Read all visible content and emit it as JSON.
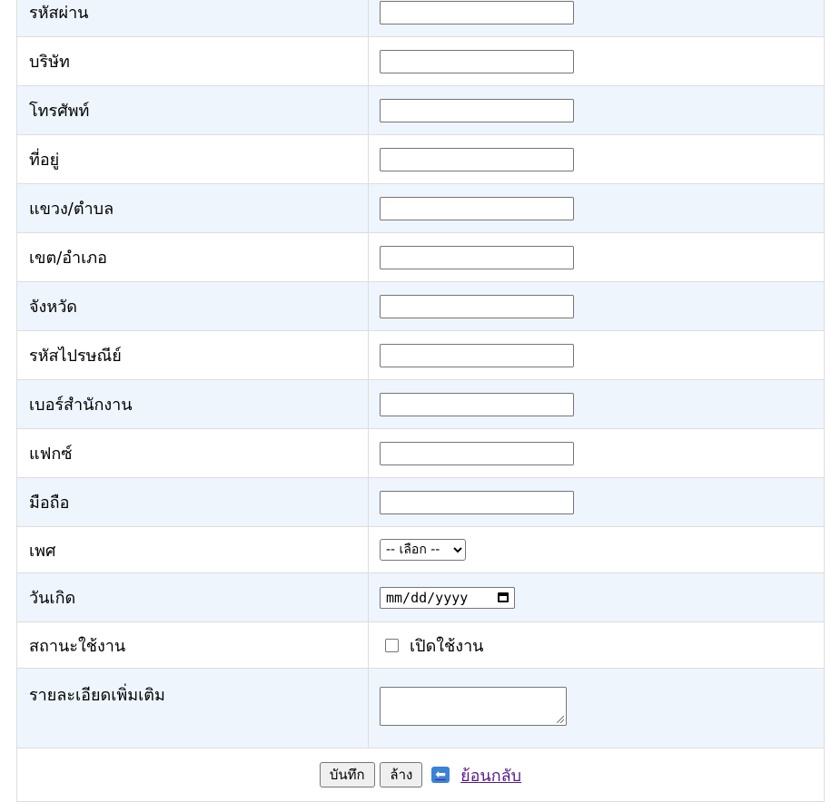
{
  "form": {
    "fields": [
      {
        "label": "รหัสผ่าน",
        "value": ""
      },
      {
        "label": "บริษัท",
        "value": ""
      },
      {
        "label": "โทรศัพท์",
        "value": ""
      },
      {
        "label": "ที่อยู่",
        "value": ""
      },
      {
        "label": "แขวง/ตำบล",
        "value": ""
      },
      {
        "label": "เขต/อำเภอ",
        "value": ""
      },
      {
        "label": "จังหวัด",
        "value": ""
      },
      {
        "label": "รหัสไปรษณีย์",
        "value": ""
      },
      {
        "label": "เบอร์สำนักงาน",
        "value": ""
      },
      {
        "label": "แฟกซ์",
        "value": ""
      },
      {
        "label": "มือถือ",
        "value": ""
      }
    ],
    "gender": {
      "label": "เพศ",
      "selected": "-- เลือก --"
    },
    "birthdate": {
      "label": "วันเกิด",
      "placeholder": "mm/dd/yyyy"
    },
    "status": {
      "label": "สถานะใช้งาน",
      "checkbox_label": "เปิดใช้งาน",
      "checked": false
    },
    "details": {
      "label": "รายละเอียดเพิ่มเติม",
      "value": ""
    }
  },
  "actions": {
    "save_label": "บันทึก",
    "clear_label": "ล้าง",
    "back_label": "ย้อนกลับ",
    "back_icon": "arrow-left-icon"
  },
  "colors": {
    "alt_row_bg": "#eef5fd",
    "border": "#dddddd",
    "link": "#551a8b",
    "back_icon_bg": "#3b82d6"
  }
}
